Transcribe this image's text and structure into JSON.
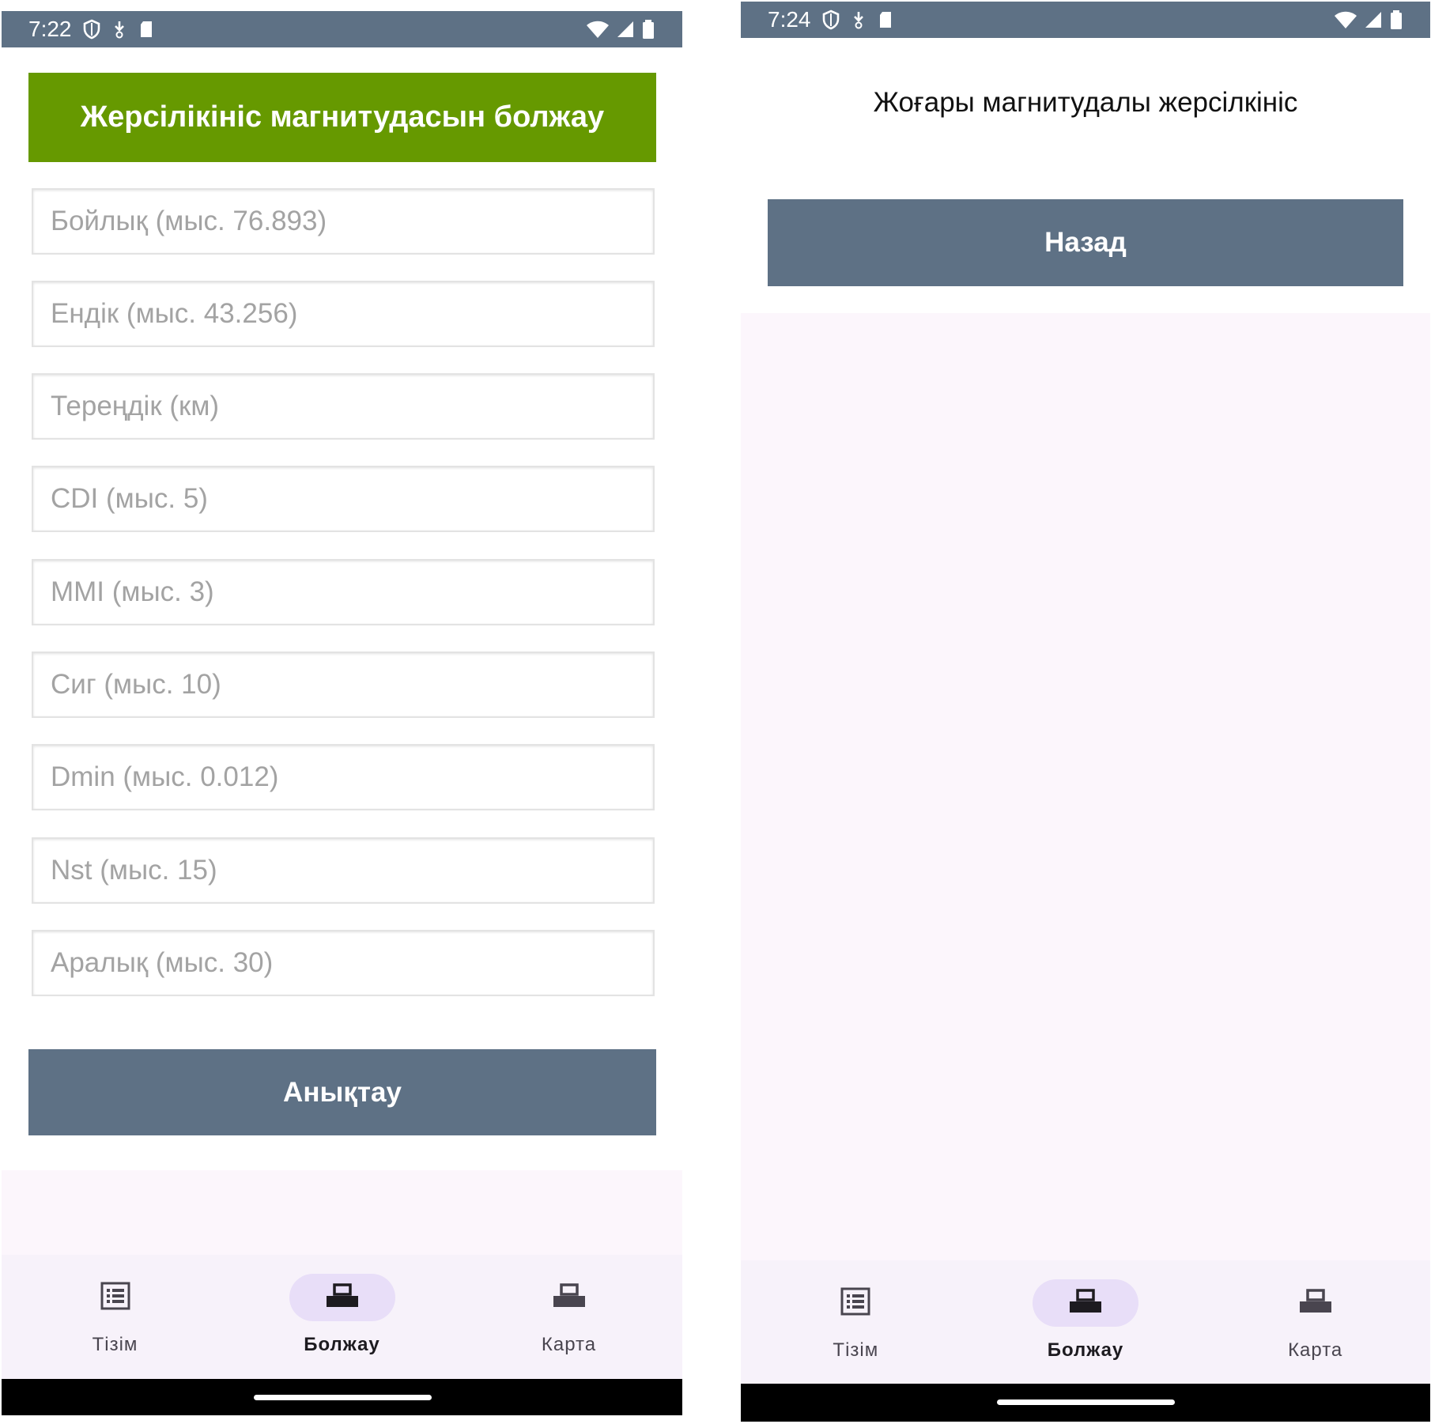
{
  "screens": [
    {
      "status": {
        "time": "7:22"
      },
      "header": {
        "title": "Жерсілікініс магнитудасын болжау"
      },
      "fields": [
        {
          "placeholder": "Бойлық (мыс. 76.893)"
        },
        {
          "placeholder": "Ендік (мыс. 43.256)"
        },
        {
          "placeholder": "Тереңдік (км)"
        },
        {
          "placeholder": "CDI (мыс. 5)"
        },
        {
          "placeholder": "MMI (мыс. 3)"
        },
        {
          "placeholder": "Сиг (мыс. 10)"
        },
        {
          "placeholder": "Dmin (мыс. 0.012)"
        },
        {
          "placeholder": "Nst (мыс. 15)"
        },
        {
          "placeholder": "Аралық (мыс. 30)"
        }
      ],
      "submit_label": "Анықтау",
      "nav": [
        {
          "label": "Тізім",
          "icon": "list-icon",
          "active": false
        },
        {
          "label": "Болжау",
          "icon": "printer-icon",
          "active": true
        },
        {
          "label": "Карта",
          "icon": "printer-icon",
          "active": false
        }
      ]
    },
    {
      "status": {
        "time": "7:24"
      },
      "result_text": "Жоғары магнитудалы жерсілкініс",
      "back_label": "Назад",
      "nav": [
        {
          "label": "Тізім",
          "icon": "list-icon",
          "active": false
        },
        {
          "label": "Болжау",
          "icon": "printer-icon",
          "active": true
        },
        {
          "label": "Карта",
          "icon": "printer-icon",
          "active": false
        }
      ]
    }
  ],
  "colors": {
    "status_bar": "#5e7185",
    "header_green": "#669900",
    "button": "#5e7185",
    "nav_active_pill": "#e8def8",
    "background": "#fcf6fc"
  }
}
